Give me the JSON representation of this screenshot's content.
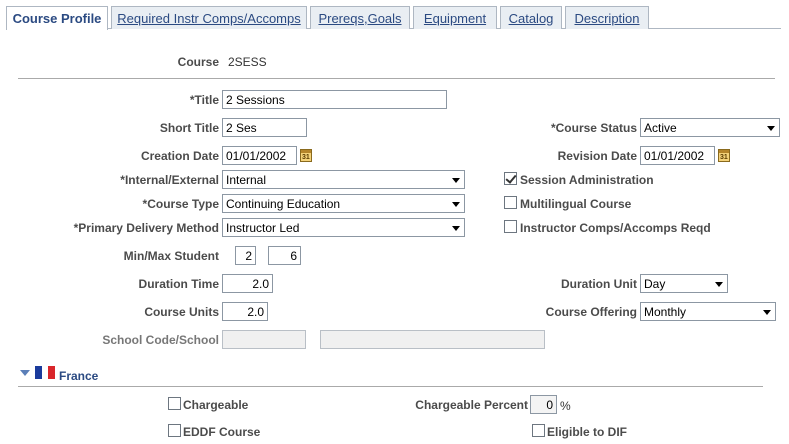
{
  "tabs": [
    {
      "label": "Course Profile"
    },
    {
      "label": "Required Instr Comps/Accomps"
    },
    {
      "label": "Prereqs,Goals"
    },
    {
      "label": "Equipment"
    },
    {
      "label": "Catalog"
    },
    {
      "label": "Description"
    }
  ],
  "course": {
    "label": "Course",
    "value": "2SESS"
  },
  "title": {
    "label": "*Title",
    "value": "2 Sessions"
  },
  "short_title": {
    "label": "Short Title",
    "value": "2 Ses"
  },
  "course_status": {
    "label": "*Course Status",
    "value": "Active"
  },
  "creation_date": {
    "label": "Creation Date",
    "value": "01/01/2002"
  },
  "revision_date": {
    "label": "Revision Date",
    "value": "01/01/2002"
  },
  "calendar_glyph": "31",
  "internal_external": {
    "label": "*Internal/External",
    "value": "Internal"
  },
  "session_admin": {
    "label": "Session Administration",
    "checked": true
  },
  "course_type": {
    "label": "*Course Type",
    "value": "Continuing Education"
  },
  "multilingual": {
    "label": "Multilingual Course",
    "checked": false
  },
  "delivery_method": {
    "label": "*Primary Delivery Method",
    "value": "Instructor Led"
  },
  "instr_comps_reqd": {
    "label": "Instructor Comps/Accomps Reqd",
    "checked": false
  },
  "min_max_student": {
    "label": "Min/Max Student",
    "min": "2",
    "max": "6"
  },
  "duration_time": {
    "label": "Duration Time",
    "value": "2.0"
  },
  "duration_unit": {
    "label": "Duration Unit",
    "value": "Day"
  },
  "course_units": {
    "label": "Course Units",
    "value": "2.0"
  },
  "course_offering": {
    "label": "Course Offering",
    "value": "Monthly"
  },
  "school": {
    "label": "School Code/School",
    "code": "",
    "name": ""
  },
  "france": {
    "title": "France",
    "flag_colors": [
      "#1a3b9c",
      "#ffffff",
      "#d9262b"
    ],
    "chargeable": {
      "label": "Chargeable",
      "checked": false
    },
    "chargeable_percent": {
      "label": "Chargeable Percent",
      "value": "0",
      "unit": "%"
    },
    "eddf_course": {
      "label": "EDDF Course",
      "checked": false
    },
    "eligible_dif": {
      "label": "Eligible to DIF",
      "checked": false
    }
  }
}
